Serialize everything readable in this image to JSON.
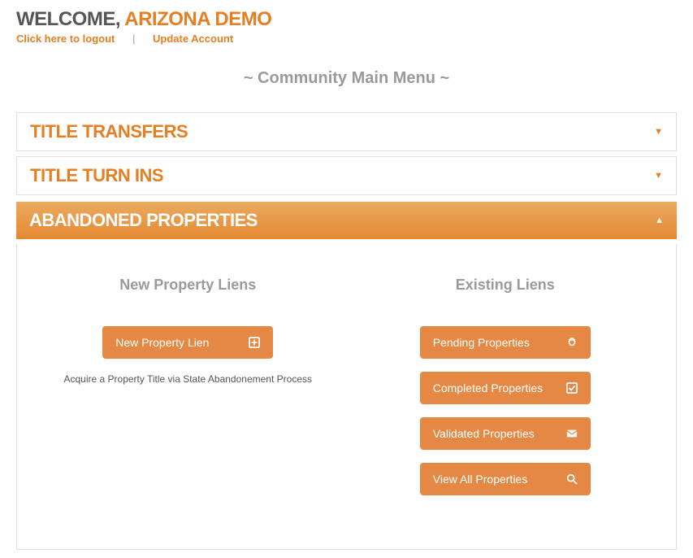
{
  "header": {
    "welcome_prefix": "WELCOME, ",
    "welcome_name": "ARIZONA DEMO",
    "logout_label": "Click here to logout",
    "update_label": "Update Account"
  },
  "menu_title": "~ Community Main Menu ~",
  "accordion": {
    "title_transfers": "TITLE TRANSFERS",
    "title_turn_ins": "TITLE TURN INS",
    "abandoned_properties": "ABANDONED PROPERTIES"
  },
  "panel": {
    "left": {
      "title": "New Property Liens",
      "new_lien_btn": "New Property Lien",
      "helper": "Acquire a Property Title via State Abandonement Process"
    },
    "right": {
      "title": "Existing Liens",
      "pending_btn": "Pending Properties",
      "completed_btn": "Completed Properties",
      "validated_btn": "Validated Properties",
      "view_all_btn": "View All Properties"
    }
  }
}
